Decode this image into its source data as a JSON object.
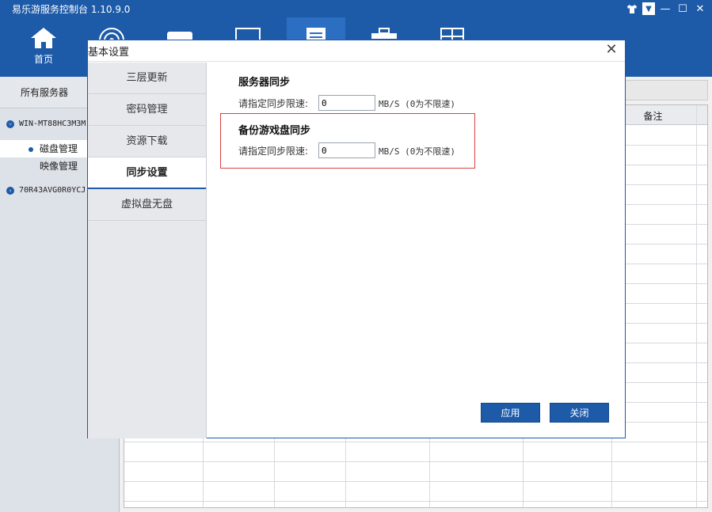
{
  "app": {
    "title": "易乐游服务控制台 1.10.9.0"
  },
  "window_controls": [
    "shirt-icon",
    "dropdown-icon",
    "minimize-icon",
    "maximize-icon",
    "close-icon"
  ],
  "nav": {
    "tabs": [
      {
        "label": "首页",
        "icon": "home-icon",
        "active": false
      },
      {
        "label": "",
        "icon": "disc-icon",
        "active": false
      },
      {
        "label": "",
        "icon": "gamepad-icon",
        "active": false
      },
      {
        "label": "",
        "icon": "monitor-icon",
        "active": false
      },
      {
        "label": "",
        "icon": "document-icon",
        "active": true
      },
      {
        "label": "",
        "icon": "toolbox-icon",
        "active": false
      },
      {
        "label": "",
        "icon": "window-grid-icon",
        "active": false
      }
    ]
  },
  "left_panel": {
    "header": "所有服务器",
    "server1": "WIN-MT88HC3M3M",
    "sub_disk": "磁盘管理",
    "sub_image": "映像管理",
    "server2": "70R43AVG0R0YCJ"
  },
  "grid": {
    "remark_header": "备注"
  },
  "dialog": {
    "title": "基本设置",
    "menu": [
      "三层更新",
      "密码管理",
      "资源下载",
      "同步设置",
      "虚拟盘无盘"
    ],
    "active_menu": "同步设置",
    "server_sync": {
      "title": "服务器同步",
      "label": "请指定同步限速:",
      "value": "0",
      "unit": "MB/S  (0为不限速)"
    },
    "backup_sync": {
      "title": "备份游戏盘同步",
      "label": "请指定同步限速:",
      "value": "0",
      "unit": "MB/S  (0为不限速)"
    },
    "apply_label": "应用",
    "close_label": "关闭"
  },
  "colors": {
    "brand": "#1d5aa8",
    "highlight": "#d94040"
  }
}
